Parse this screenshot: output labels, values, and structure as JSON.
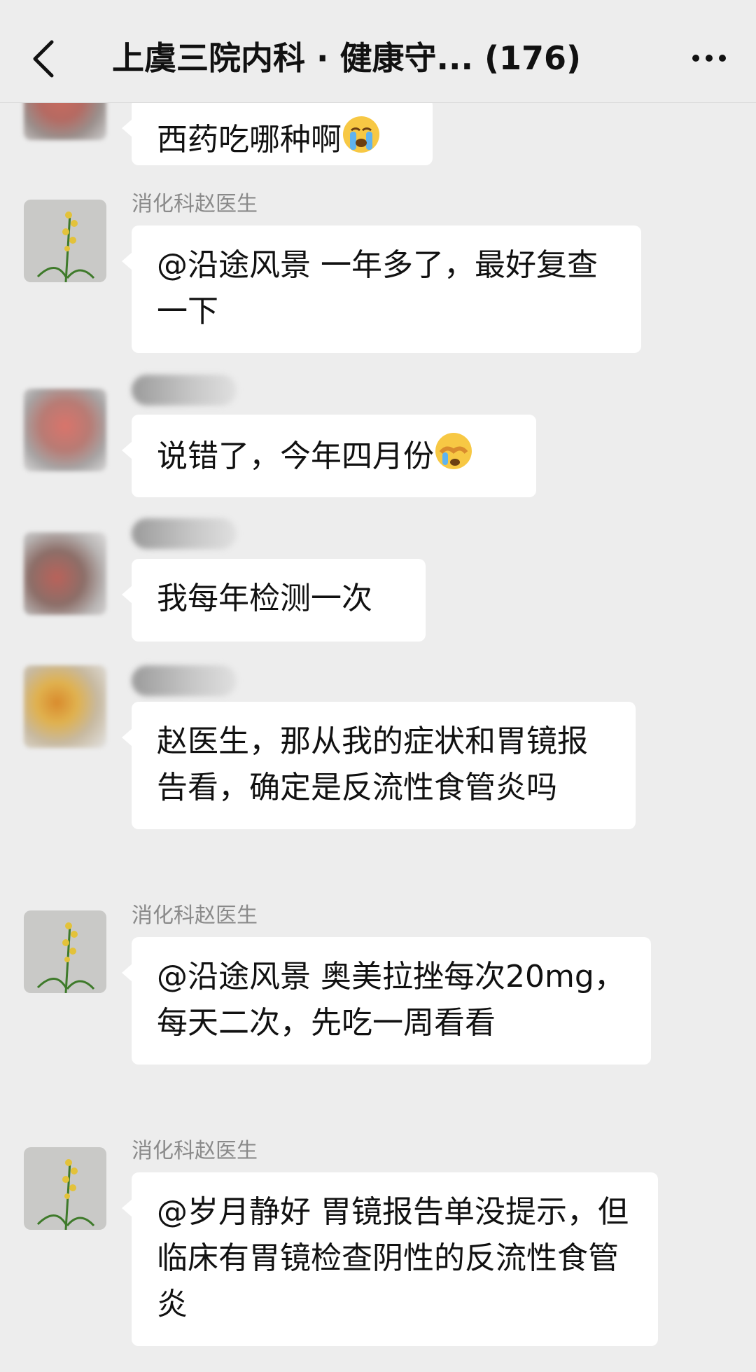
{
  "header": {
    "title": "上虞三院内科 · 健康守...  (176)"
  },
  "messages": [
    {
      "sender": "",
      "text": "西药吃哪种啊",
      "emoji": "loudly-crying-face"
    },
    {
      "sender": "消化科赵医生",
      "text": "@沿途风景 一年多了，最好复查一下"
    },
    {
      "sender": "",
      "text": "说错了，今年四月份",
      "emoji": "face-with-tears-covering"
    },
    {
      "sender": "",
      "text": "我每年检测一次"
    },
    {
      "sender": "",
      "text": "赵医生，那从我的症状和胃镜报告看，确定是反流性食管炎吗"
    },
    {
      "sender": "消化科赵医生",
      "text": "@沿途风景 奥美拉挫每次20mg，每天二次，先吃一周看看"
    },
    {
      "sender": "消化科赵医生",
      "text": "@岁月静好 胃镜报告单没提示，但临床有胃镜检查阴性的反流性食管炎"
    }
  ],
  "colors": {
    "background": "#ededed",
    "bubble": "#ffffff",
    "sender_name": "#8a8a8a"
  }
}
